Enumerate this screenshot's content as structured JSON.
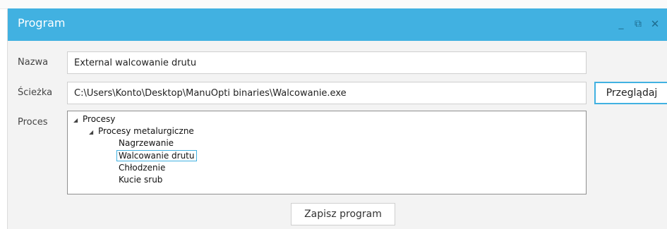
{
  "window": {
    "title": "Program",
    "minimize_glyph": "_",
    "maximize_glyph": "⧉",
    "close_glyph": "✕",
    "accent_color": "#41b1e1"
  },
  "form": {
    "name_label": "Nazwa",
    "name_value": "External walcowanie drutu",
    "path_label": "Ścieżka",
    "path_value": "C:\\Users\\Konto\\Desktop\\ManuOpti binaries\\Walcowanie.exe",
    "browse_label": "Przeglądaj",
    "process_label": "Proces",
    "save_label": "Zapisz program"
  },
  "tree": {
    "expand_glyph": "◢",
    "root": "Procesy",
    "group": "Procesy metalurgiczne",
    "items": [
      "Nagrzewanie",
      "Walcowanie drutu",
      "Chłodzenie",
      "Kucie srub"
    ],
    "selected": "Walcowanie drutu"
  }
}
